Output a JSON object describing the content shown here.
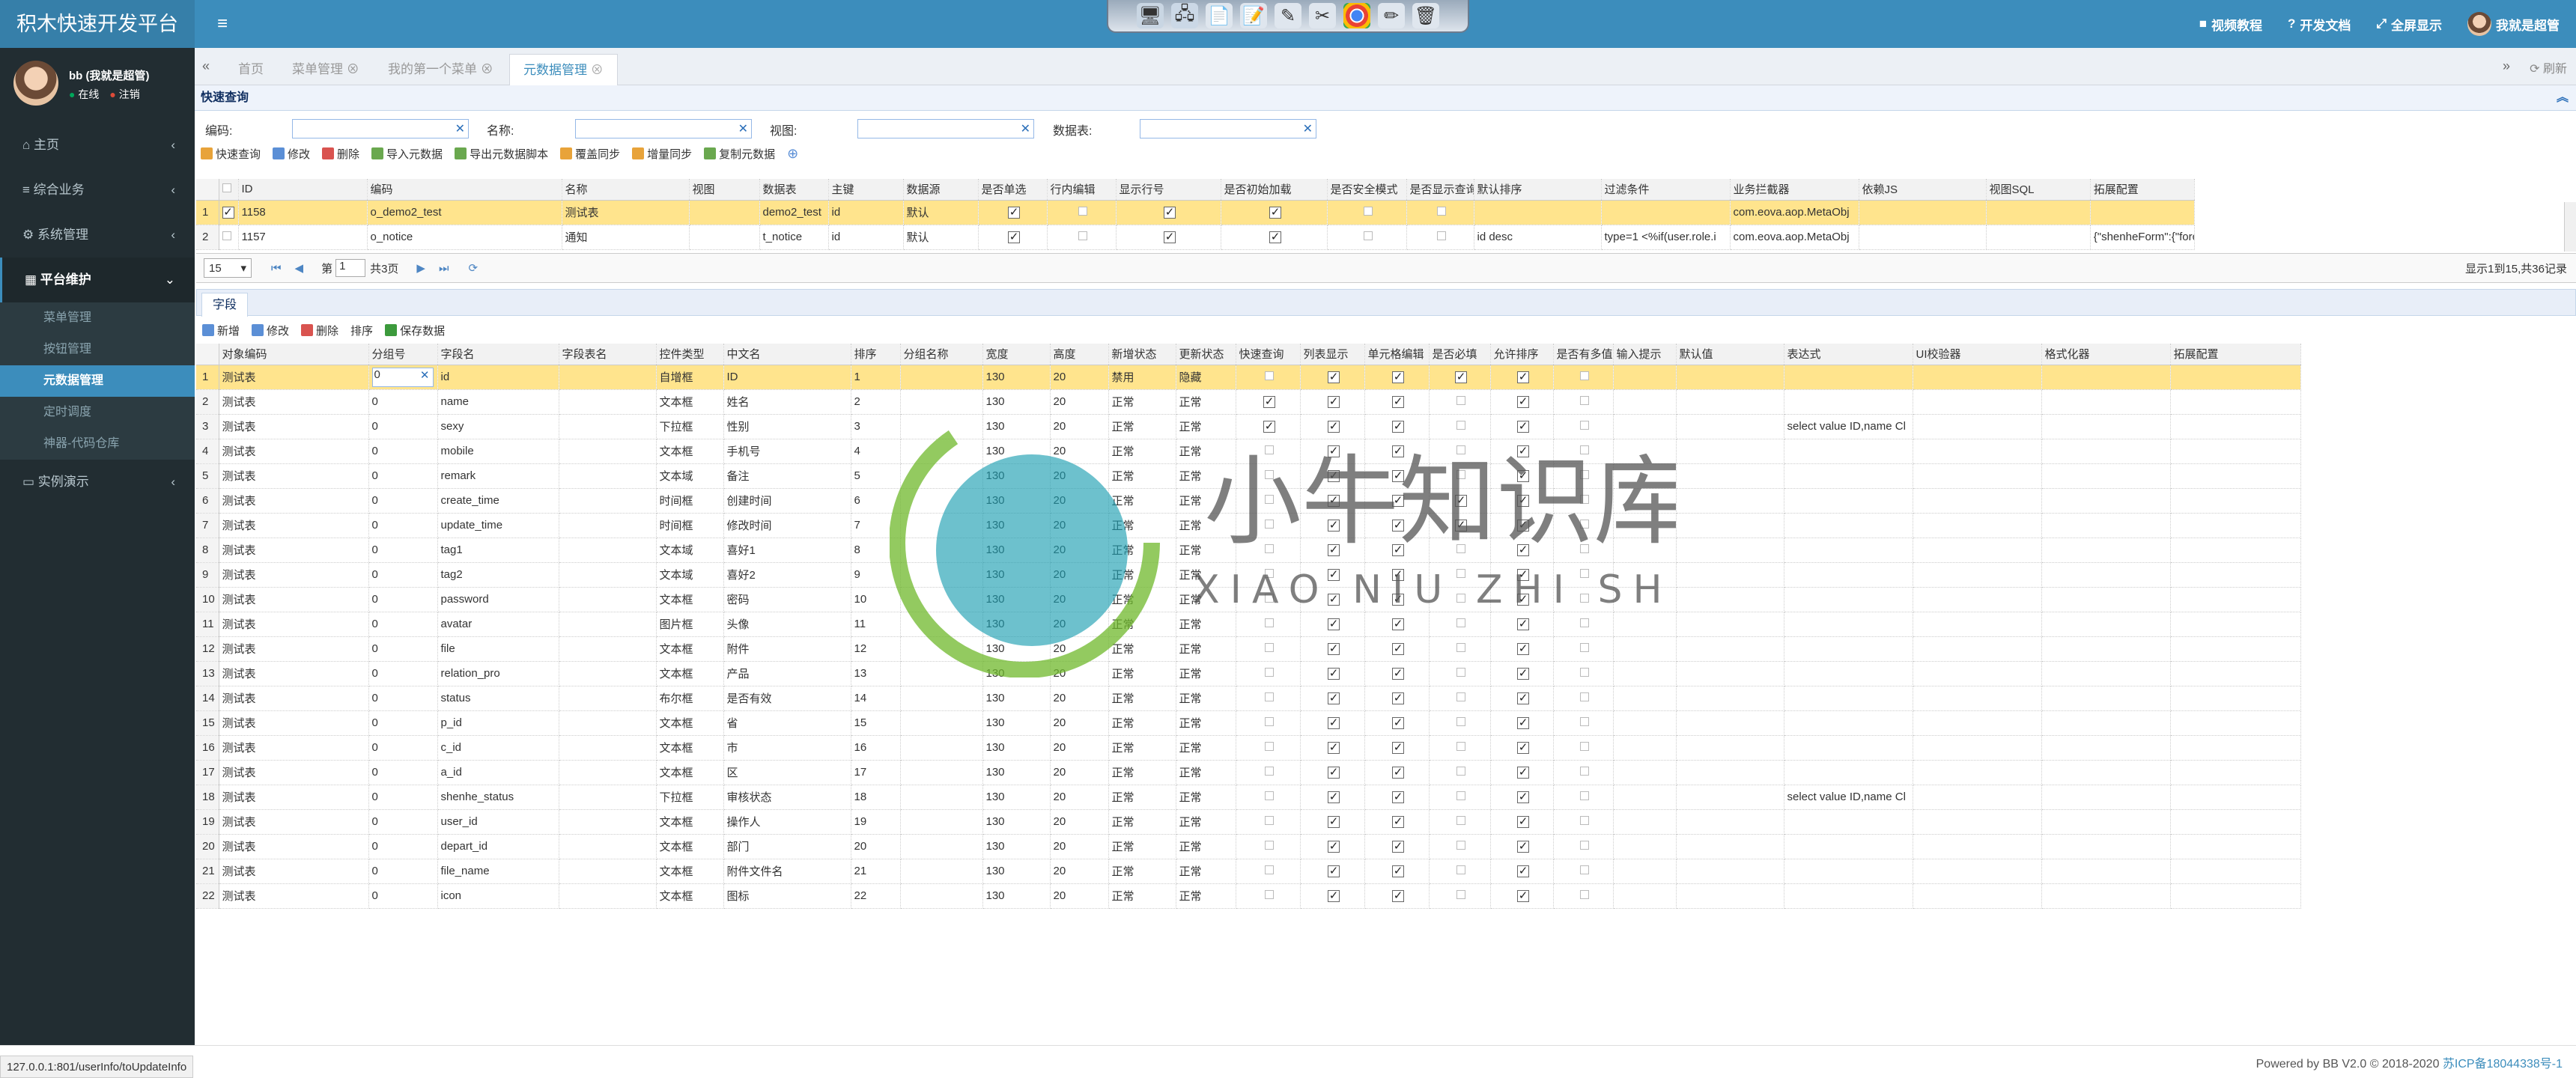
{
  "app": {
    "title": "积木快速开发平台"
  },
  "header": {
    "video_label": "视频教程",
    "docs_label": "开发文档",
    "fullscreen_label": "全屏显示",
    "user_label": "我就是超管"
  },
  "user": {
    "name": "bb (我就是超管)",
    "online": "在线",
    "logout": "注销"
  },
  "sidebar": {
    "items": [
      {
        "label": "主页"
      },
      {
        "label": "综合业务"
      },
      {
        "label": "系统管理"
      },
      {
        "label": "平台维护"
      },
      {
        "label": "实例演示"
      }
    ],
    "submenu": [
      "菜单管理",
      "按钮管理",
      "元数据管理",
      "定时调度",
      "神器-代码仓库"
    ]
  },
  "tabs": [
    "首页",
    "菜单管理",
    "我的第一个菜单",
    "元数据管理"
  ],
  "refresh_label": "刷新",
  "quick_query": {
    "title": "快速查询",
    "labels": [
      "编码:",
      "名称:",
      "视图:",
      "数据表:"
    ]
  },
  "meta_toolbar": [
    "快速查询",
    "修改",
    "删除",
    "导入元数据",
    "导出元数据脚本",
    "覆盖同步",
    "增量同步",
    "复制元数据"
  ],
  "meta_grid": {
    "columns": [
      "ID",
      "编码",
      "名称",
      "视图",
      "数据表",
      "主键",
      "数据源",
      "是否单选",
      "行内编辑",
      "显示行号",
      "是否初始加载",
      "是否安全模式",
      "是否显示查询框",
      "默认排序",
      "过滤条件",
      "业务拦截器",
      "依赖JS",
      "视图SQL",
      "拓展配置"
    ],
    "rows": [
      {
        "n": "1",
        "id": "1158",
        "code": "o_demo2_test",
        "name": "测试表",
        "view": "",
        "table": "demo2_test",
        "pk": "id",
        "ds": "默认",
        "single": true,
        "inline": false,
        "rownum": true,
        "init": true,
        "safe": false,
        "showq": false,
        "sort": "",
        "filter": "",
        "interceptor": "com.eova.aop.MetaObj",
        "js": "",
        "sql": "",
        "ext": ""
      },
      {
        "n": "2",
        "id": "1157",
        "code": "o_notice",
        "name": "通知",
        "view": "",
        "table": "t_notice",
        "pk": "id",
        "ds": "默认",
        "single": true,
        "inline": false,
        "rownum": true,
        "init": true,
        "safe": false,
        "showq": false,
        "sort": "id desc",
        "filter": "type=1  <%if(user.role.i",
        "interceptor": "com.eova.aop.MetaObj",
        "js": "",
        "sql": "",
        "ext": "{\"shenheForm\":{\"force\":"
      }
    ]
  },
  "pager": {
    "size": "15",
    "page_prefix": "第",
    "page": "1",
    "page_suffix": "共3页",
    "summary": "显示1到15,共36记录"
  },
  "field_tab": "字段",
  "field_toolbar": [
    "新增",
    "修改",
    "删除",
    "排序",
    "保存数据"
  ],
  "field_grid": {
    "columns": [
      "对象编码",
      "分组号",
      "字段名",
      "字段表名",
      "控件类型",
      "中文名",
      "排序",
      "分组名称",
      "宽度",
      "高度",
      "新增状态",
      "更新状态",
      "快速查询",
      "列表显示",
      "单元格编辑",
      "是否必填",
      "允许排序",
      "是否有多值",
      "输入提示",
      "默认值",
      "表达式",
      "UI校验器",
      "格式化器",
      "拓展配置"
    ],
    "rows": [
      [
        "1",
        "测试表",
        "0",
        "id",
        "",
        "自增框",
        "ID",
        "1",
        "",
        "130",
        "20",
        "禁用",
        "隐藏",
        false,
        true,
        true,
        true,
        true,
        false,
        "",
        "",
        "",
        ""
      ],
      [
        "2",
        "测试表",
        "0",
        "name",
        "",
        "文本框",
        "姓名",
        "2",
        "",
        "130",
        "20",
        "正常",
        "正常",
        true,
        true,
        true,
        false,
        true,
        false,
        "",
        "",
        "",
        ""
      ],
      [
        "3",
        "测试表",
        "0",
        "sexy",
        "",
        "下拉框",
        "性别",
        "3",
        "",
        "130",
        "20",
        "正常",
        "正常",
        true,
        true,
        true,
        false,
        true,
        false,
        "",
        "",
        "select value ID,name Cl",
        ""
      ],
      [
        "4",
        "测试表",
        "0",
        "mobile",
        "",
        "文本框",
        "手机号",
        "4",
        "",
        "130",
        "20",
        "正常",
        "正常",
        false,
        true,
        true,
        false,
        true,
        false,
        "",
        "",
        "",
        ""
      ],
      [
        "5",
        "测试表",
        "0",
        "remark",
        "",
        "文本域",
        "备注",
        "5",
        "",
        "130",
        "20",
        "正常",
        "正常",
        false,
        true,
        true,
        false,
        true,
        false,
        "",
        "",
        "",
        ""
      ],
      [
        "6",
        "测试表",
        "0",
        "create_time",
        "",
        "时间框",
        "创建时间",
        "6",
        "",
        "130",
        "20",
        "正常",
        "正常",
        false,
        true,
        true,
        true,
        true,
        false,
        "",
        "",
        "",
        ""
      ],
      [
        "7",
        "测试表",
        "0",
        "update_time",
        "",
        "时间框",
        "修改时间",
        "7",
        "",
        "130",
        "20",
        "正常",
        "正常",
        false,
        true,
        true,
        true,
        true,
        false,
        "",
        "",
        "",
        ""
      ],
      [
        "8",
        "测试表",
        "0",
        "tag1",
        "",
        "文本域",
        "喜好1",
        "8",
        "",
        "130",
        "20",
        "正常",
        "正常",
        false,
        true,
        true,
        false,
        true,
        false,
        "",
        "",
        "",
        ""
      ],
      [
        "9",
        "测试表",
        "0",
        "tag2",
        "",
        "文本域",
        "喜好2",
        "9",
        "",
        "130",
        "20",
        "正常",
        "正常",
        false,
        true,
        true,
        false,
        true,
        false,
        "",
        "",
        "",
        ""
      ],
      [
        "10",
        "测试表",
        "0",
        "password",
        "",
        "文本框",
        "密码",
        "10",
        "",
        "130",
        "20",
        "正常",
        "正常",
        false,
        true,
        true,
        false,
        true,
        false,
        "",
        "",
        "",
        ""
      ],
      [
        "11",
        "测试表",
        "0",
        "avatar",
        "",
        "图片框",
        "头像",
        "11",
        "",
        "130",
        "20",
        "正常",
        "正常",
        false,
        true,
        true,
        false,
        true,
        false,
        "",
        "",
        "",
        ""
      ],
      [
        "12",
        "测试表",
        "0",
        "file",
        "",
        "文本框",
        "附件",
        "12",
        "",
        "130",
        "20",
        "正常",
        "正常",
        false,
        true,
        true,
        false,
        true,
        false,
        "",
        "",
        "",
        ""
      ],
      [
        "13",
        "测试表",
        "0",
        "relation_pro",
        "",
        "文本框",
        "产品",
        "13",
        "",
        "130",
        "20",
        "正常",
        "正常",
        false,
        true,
        true,
        false,
        true,
        false,
        "",
        "",
        "",
        ""
      ],
      [
        "14",
        "测试表",
        "0",
        "status",
        "",
        "布尔框",
        "是否有效",
        "14",
        "",
        "130",
        "20",
        "正常",
        "正常",
        false,
        true,
        true,
        false,
        true,
        false,
        "",
        "",
        "",
        ""
      ],
      [
        "15",
        "测试表",
        "0",
        "p_id",
        "",
        "文本框",
        "省",
        "15",
        "",
        "130",
        "20",
        "正常",
        "正常",
        false,
        true,
        true,
        false,
        true,
        false,
        "",
        "",
        "",
        ""
      ],
      [
        "16",
        "测试表",
        "0",
        "c_id",
        "",
        "文本框",
        "市",
        "16",
        "",
        "130",
        "20",
        "正常",
        "正常",
        false,
        true,
        true,
        false,
        true,
        false,
        "",
        "",
        "",
        ""
      ],
      [
        "17",
        "测试表",
        "0",
        "a_id",
        "",
        "文本框",
        "区",
        "17",
        "",
        "130",
        "20",
        "正常",
        "正常",
        false,
        true,
        true,
        false,
        true,
        false,
        "",
        "",
        "",
        ""
      ],
      [
        "18",
        "测试表",
        "0",
        "shenhe_status",
        "",
        "下拉框",
        "审核状态",
        "18",
        "",
        "130",
        "20",
        "正常",
        "正常",
        false,
        true,
        true,
        false,
        true,
        false,
        "",
        "",
        "select value ID,name Cl",
        ""
      ],
      [
        "19",
        "测试表",
        "0",
        "user_id",
        "",
        "文本框",
        "操作人",
        "19",
        "",
        "130",
        "20",
        "正常",
        "正常",
        false,
        true,
        true,
        false,
        true,
        false,
        "",
        "",
        "",
        ""
      ],
      [
        "20",
        "测试表",
        "0",
        "depart_id",
        "",
        "文本框",
        "部门",
        "20",
        "",
        "130",
        "20",
        "正常",
        "正常",
        false,
        true,
        true,
        false,
        true,
        false,
        "",
        "",
        "",
        ""
      ],
      [
        "21",
        "测试表",
        "0",
        "file_name",
        "",
        "文本框",
        "附件文件名",
        "21",
        "",
        "130",
        "20",
        "正常",
        "正常",
        false,
        true,
        true,
        false,
        true,
        false,
        "",
        "",
        "",
        ""
      ],
      [
        "22",
        "测试表",
        "0",
        "icon",
        "",
        "文本框",
        "图标",
        "22",
        "",
        "130",
        "20",
        "正常",
        "正常",
        false,
        true,
        true,
        false,
        true,
        false,
        "",
        "",
        "",
        ""
      ]
    ]
  },
  "watermark": {
    "cn": "小牛知识库",
    "en": "XIAO NIU ZHI SHI KU"
  },
  "status_url": "127.0.0.1:801/userInfo/toUpdateInfo",
  "footer": {
    "text": "Powered by BB V2.0 © 2018-2020 ",
    "icp": "苏ICP备18044338号-1"
  }
}
